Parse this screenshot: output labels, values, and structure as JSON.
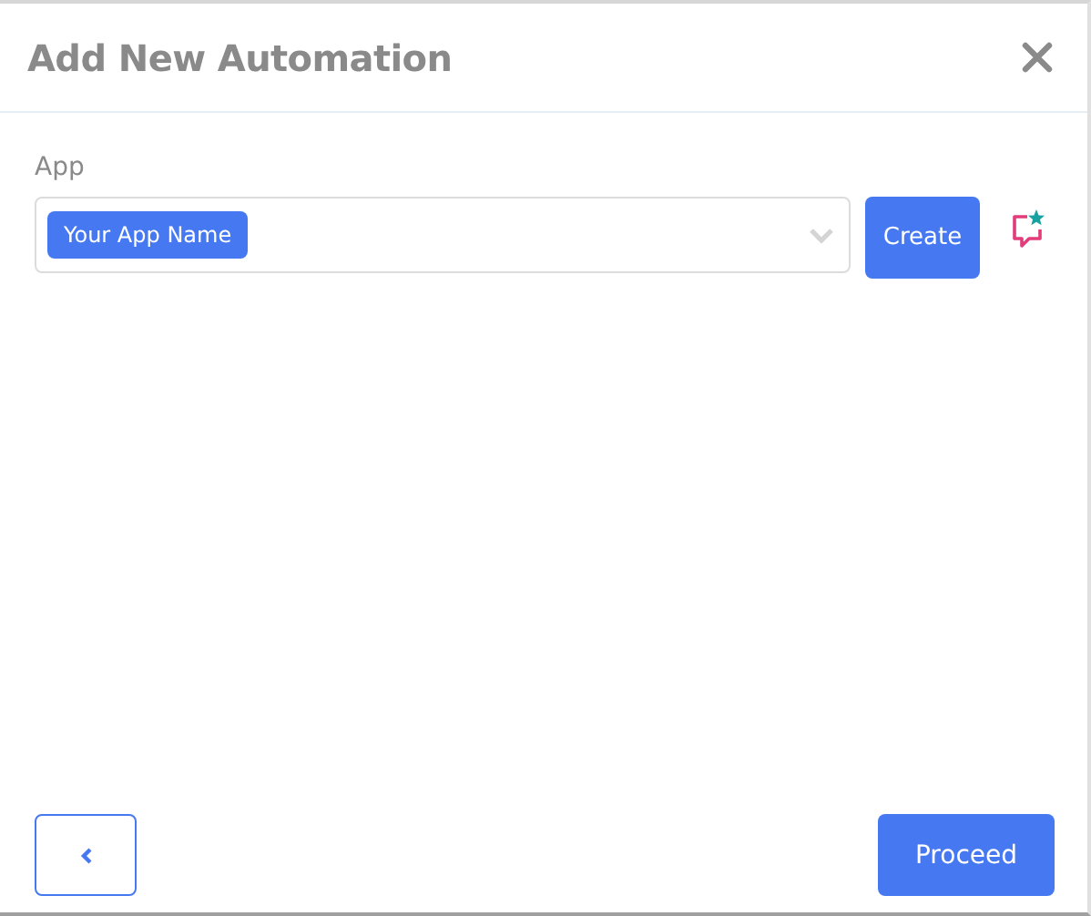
{
  "dialog": {
    "title": "Add New Automation"
  },
  "app_field": {
    "label": "App",
    "tags": [
      "Your App Name"
    ]
  },
  "buttons": {
    "create": "Create",
    "proceed": "Proceed"
  }
}
